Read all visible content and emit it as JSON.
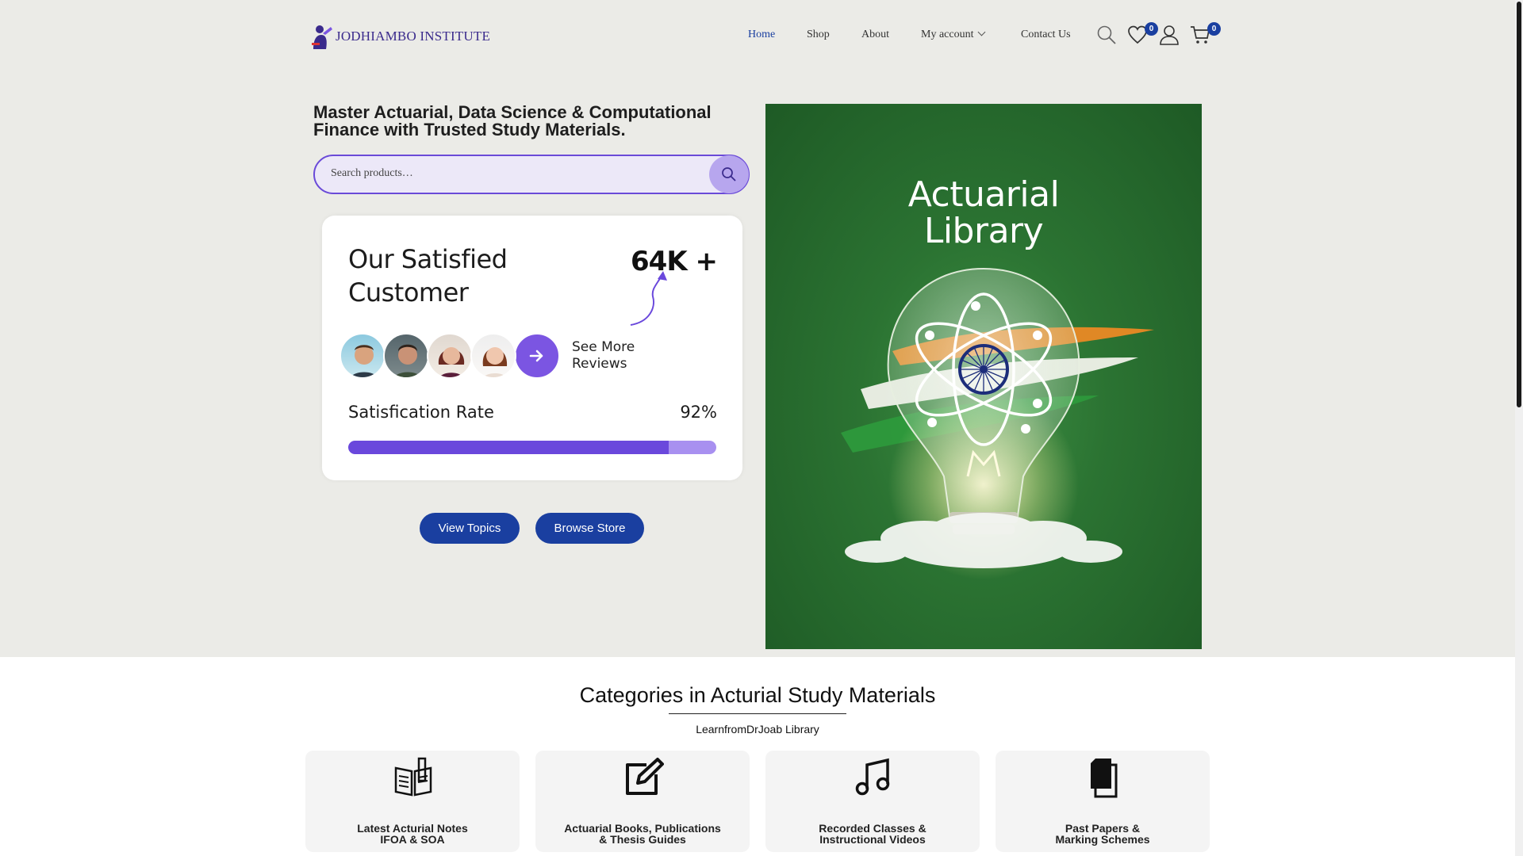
{
  "header": {
    "logo_text": "JODHIAMBO INSTITUTE",
    "nav": {
      "home": "Home",
      "shop": "Shop",
      "about": "About",
      "my_account": "My account",
      "contact": "Contact Us"
    },
    "wishlist_count": "0",
    "cart_count": "0"
  },
  "hero": {
    "title": "Master Actuarial, Data Science & Computational Finance with Trusted Study Materials.",
    "search_placeholder": "Search products…",
    "card": {
      "title": "Our Satisfied Customer",
      "count": "64K +",
      "see_more": "See More Reviews",
      "satisfaction_label": "Satisfication Rate",
      "satisfaction_value": "92%",
      "satisfaction_fraction": 0.87
    },
    "buttons": {
      "view_topics": "View Topics",
      "browse_store": "Browse Store"
    },
    "image_title": "Actuarial Library"
  },
  "categories": {
    "title": "Categories in Acturial Study Materials",
    "subtitle": "LearnfromDrJoab Library",
    "items": [
      {
        "label": "Latest Acturial Notes\nIFOA & SOA",
        "icon": "notes-icon"
      },
      {
        "label": "Actuarial Books, Publications\n& Thesis Guides",
        "icon": "edit-icon"
      },
      {
        "label": "Recorded Classes &\nInstructional Videos",
        "icon": "music-note-icon"
      },
      {
        "label": "Past Papers &\nMarking Schemes",
        "icon": "documents-icon"
      }
    ]
  },
  "colors": {
    "brand_blue": "#1a3fa0",
    "accent_purple": "#6a48dc",
    "page_bg": "#ebebe7",
    "chalkboard_green": "#2b7332"
  }
}
